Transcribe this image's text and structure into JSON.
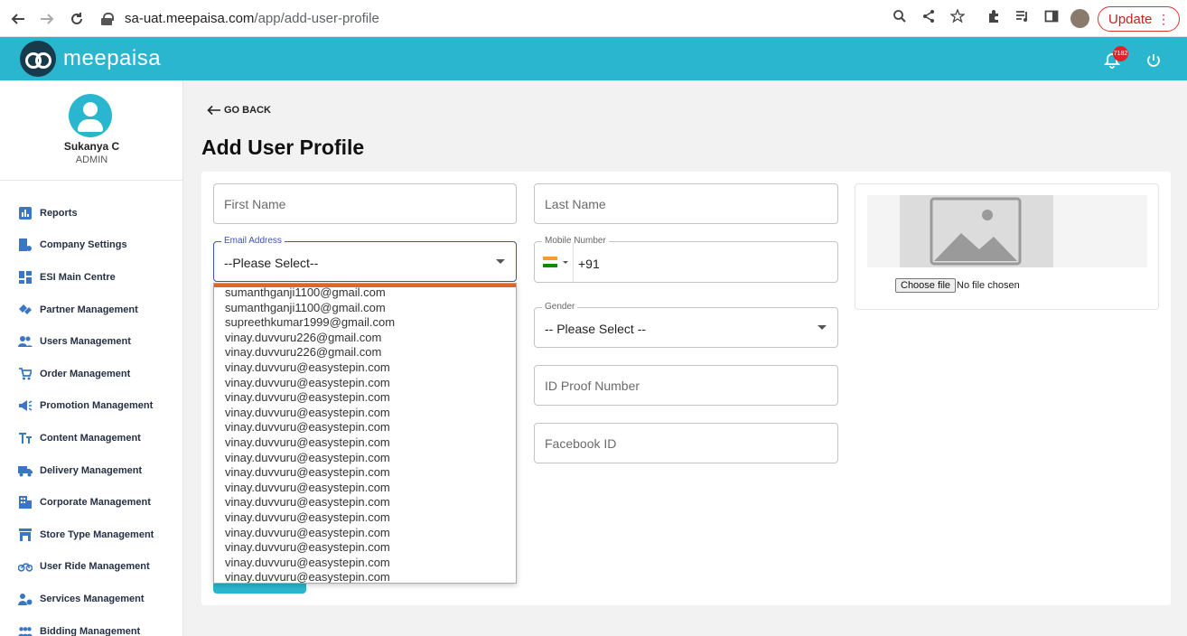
{
  "browser": {
    "url_host": "sa-uat.meepaisa.com",
    "url_path": "/app/add-user-profile",
    "update_label": "Update"
  },
  "header": {
    "brand": "meepaisa",
    "notification_count": "7182",
    "accent_color": "#2bb6cf"
  },
  "user": {
    "name": "Sukanya C",
    "role": "ADMIN"
  },
  "sidebar": {
    "items": [
      {
        "label": "Reports",
        "icon": "bar-chart-icon"
      },
      {
        "label": "Company Settings",
        "icon": "company-settings-icon"
      },
      {
        "label": "ESI Main Centre",
        "icon": "dashboard-icon"
      },
      {
        "label": "Partner Management",
        "icon": "handshake-icon"
      },
      {
        "label": "Users Management",
        "icon": "users-icon"
      },
      {
        "label": "Order Management",
        "icon": "cart-icon"
      },
      {
        "label": "Promotion Management",
        "icon": "megaphone-icon"
      },
      {
        "label": "Content Management",
        "icon": "text-icon"
      },
      {
        "label": "Delivery Management",
        "icon": "truck-icon"
      },
      {
        "label": "Corporate Management",
        "icon": "building-icon"
      },
      {
        "label": "Store Type Management",
        "icon": "store-icon"
      },
      {
        "label": "User Ride Management",
        "icon": "bike-icon"
      },
      {
        "label": "Services Management",
        "icon": "services-icon"
      },
      {
        "label": "Bidding Management",
        "icon": "bidding-icon"
      }
    ]
  },
  "main": {
    "go_back": "GO BACK",
    "title": "Add User Profile",
    "first_name_placeholder": "First Name",
    "last_name_placeholder": "Last Name",
    "email_label": "Email Address",
    "email_value": "--Please Select--",
    "mobile_label": "Mobile Number",
    "dial_code": "+91",
    "gender_label": "Gender",
    "gender_value": "-- Please Select --",
    "id_proof_placeholder": "ID Proof Number",
    "facebook_placeholder": "Facebook ID",
    "choose_file": "Choose file",
    "no_file": "No file chosen"
  },
  "email_options": [
    "sumanthganji1100@gmail.com",
    "sumanthganji1100@gmail.com",
    "supreethkumar1999@gmail.com",
    "vinay.duvvuru226@gmail.com",
    "vinay.duvvuru226@gmail.com",
    "vinay.duvvuru@easystepin.com",
    "vinay.duvvuru@easystepin.com",
    "vinay.duvvuru@easystepin.com",
    "vinay.duvvuru@easystepin.com",
    "vinay.duvvuru@easystepin.com",
    "vinay.duvvuru@easystepin.com",
    "vinay.duvvuru@easystepin.com",
    "vinay.duvvuru@easystepin.com",
    "vinay.duvvuru@easystepin.com",
    "vinay.duvvuru@easystepin.com",
    "vinay.duvvuru@easystepin.com",
    "vinay.duvvuru@easystepin.com",
    "vinay.duvvuru@easystepin.com",
    "vinay.duvvuru@easystepin.com",
    "vinay.duvvuru@easystepin.com"
  ]
}
